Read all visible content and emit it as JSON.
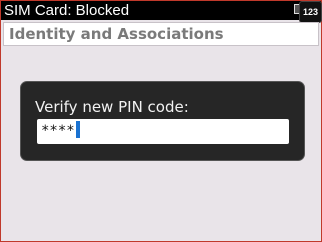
{
  "statusbar": {
    "title": "SIM Card: Blocked",
    "input_mode": "123"
  },
  "header": {
    "title": "Identity and Associations"
  },
  "dialog": {
    "label": "Verify new PIN code:",
    "pin_value": "****"
  }
}
